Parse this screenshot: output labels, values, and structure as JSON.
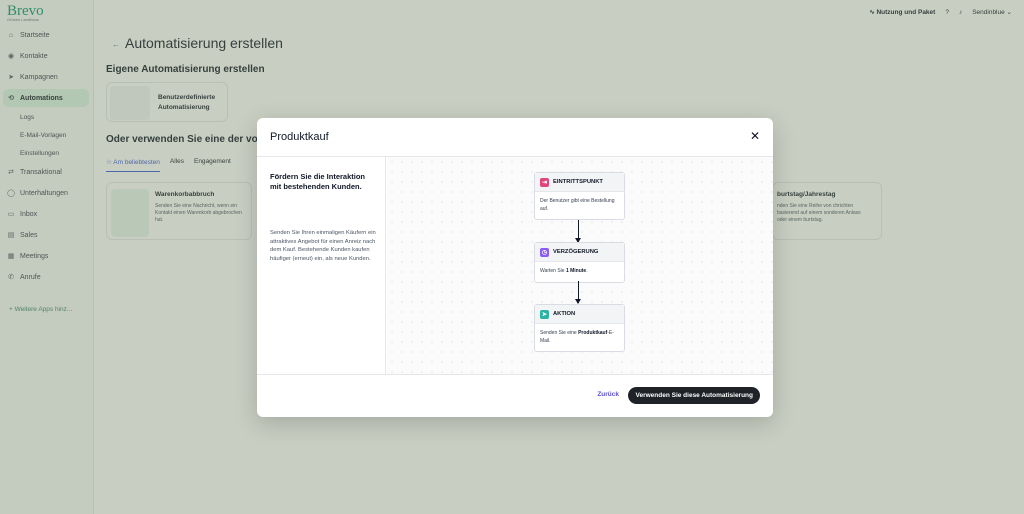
{
  "brand": {
    "logo": "Brevo",
    "company": "Grünes Landhaus"
  },
  "sidebar": {
    "items": [
      {
        "label": "Startseite",
        "icon": "home-icon"
      },
      {
        "label": "Kontakte",
        "icon": "contacts-icon"
      },
      {
        "label": "Kampagnen",
        "icon": "send-icon"
      },
      {
        "label": "Automations",
        "icon": "automation-icon"
      },
      {
        "label": "Transaktional",
        "icon": "transactional-icon"
      },
      {
        "label": "Unterhaltungen",
        "icon": "chat-icon"
      },
      {
        "label": "Inbox",
        "icon": "inbox-icon"
      },
      {
        "label": "Sales",
        "icon": "sales-icon"
      },
      {
        "label": "Meetings",
        "icon": "calendar-icon"
      },
      {
        "label": "Anrufe",
        "icon": "phone-icon"
      }
    ],
    "sub_items": [
      "Logs",
      "E-Mail-Vorlagen",
      "Einstellungen"
    ],
    "more_apps": "+ Weitere Apps hinz..."
  },
  "topbar": {
    "usage": "Nutzung und Paket",
    "account": "Sendinblue"
  },
  "page": {
    "title": "Automatisierung erstellen",
    "own_section": "Eigene Automatisierung erstellen",
    "custom_card": "Benutzerdefinierte Automatisierung",
    "templates_section": "Oder verwenden Sie eine der vor",
    "tabs": [
      "☆ Am beliebtesten",
      "Alles",
      "Engagement"
    ],
    "template_left": {
      "title": "Warenkorbabbruch",
      "desc": "Senden Sie eine Nachricht, wenn ein Kontakt einen Warenkorb abgebrochen hat."
    },
    "template_right": {
      "title": "burtstag/Jahrestag",
      "desc": "nden Sie eine Reihe von chrichten basierend auf einem sonderen Anlass oder einem burtstag."
    }
  },
  "modal": {
    "title": "Produktkauf",
    "heading": "Fördern Sie die Interaktion mit bestehenden Kunden.",
    "body": "Senden Sie Ihren einmaligen Käufern ein attraktives Angebot für einen Anreiz nach dem Kauf. Bestehende Kunden kaufen häufiger (erneut) ein, als neue Kunden.",
    "nodes": [
      {
        "title": "EINTRITTSPUNKT",
        "pre": "Der Benutzer gibt eine Bestellung auf.",
        "bold": "",
        "post": "",
        "color": "#e0457b",
        "icon": "entry-icon"
      },
      {
        "title": "VERZÖGERUNG",
        "pre": "Warten Sie ",
        "bold": "1 Minute",
        "post": ".",
        "color": "#8b5cf6",
        "icon": "clock-icon"
      },
      {
        "title": "AKTION",
        "pre": "Senden Sie eine ",
        "bold": "Produktkauf",
        "post": "-E-Mail.",
        "color": "#2bb3a3",
        "icon": "send-icon"
      }
    ],
    "back_label": "Zurück",
    "use_label": "Verwenden Sie diese Automatisierung"
  }
}
